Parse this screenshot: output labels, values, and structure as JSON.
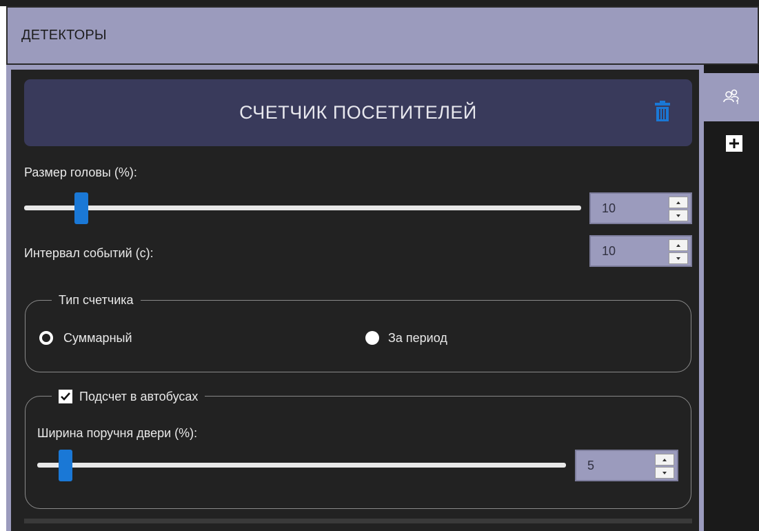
{
  "header": {
    "title": "ДЕТЕКТОРЫ"
  },
  "detector": {
    "title": "СЧЕТЧИК ПОСЕТИТЕЛЕЙ"
  },
  "head_size": {
    "label": "Размер головы (%):",
    "value": "10",
    "slider_fraction": 0.1
  },
  "event_interval": {
    "label": "Интервал событий (с):",
    "value": "10"
  },
  "counter_type": {
    "legend": "Тип счетчика",
    "options": [
      {
        "label": "Суммарный",
        "selected": true
      },
      {
        "label": "За период",
        "selected": false
      }
    ]
  },
  "bus_counting": {
    "legend": "Подсчет в автобусах",
    "checked": true,
    "door_handrail": {
      "label": "Ширина поручня двери (%):",
      "value": "5",
      "slider_fraction": 0.05
    }
  },
  "icons": {
    "trash": "trash-icon",
    "visitors": "visitors-icon",
    "add": "plus-icon"
  },
  "colors": {
    "accent": "#1a78d6",
    "header_bg": "#9b9bbd",
    "card_bg": "#393a5b",
    "panel_bg": "#222222"
  }
}
